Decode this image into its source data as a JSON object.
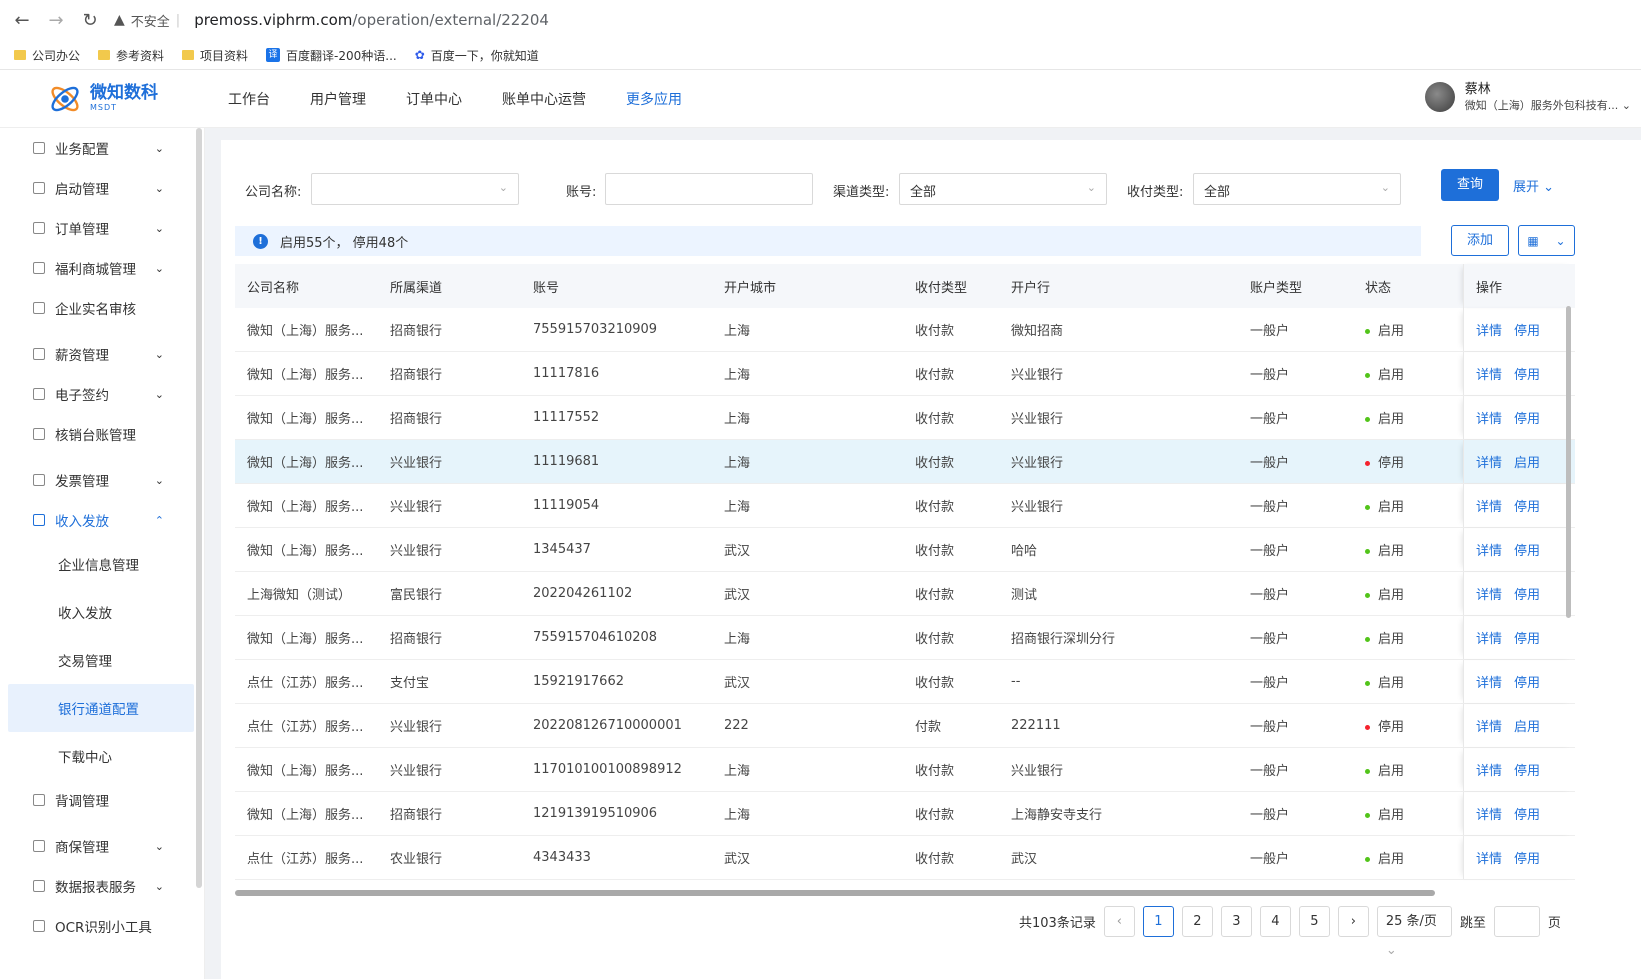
{
  "browser": {
    "security": "不安全",
    "url_host": "premoss.viphrm.com",
    "url_path": "/operation/external/22204",
    "bookmarks": [
      "公司办公",
      "参考资料",
      "项目资料",
      "百度翻译-200种语...",
      "百度一下，你就知道"
    ]
  },
  "header": {
    "logo_cn": "微知数科",
    "logo_en": "MSDT",
    "menu": [
      "工作台",
      "用户管理",
      "订单中心",
      "账单中心运营",
      "更多应用"
    ],
    "user_name": "蔡林",
    "user_org": "微知（上海）服务外包科技有...",
    "accent": "#1e6fd9"
  },
  "sidebar": {
    "items": [
      "业务配置",
      "启动管理",
      "订单管理",
      "福利商城管理",
      "企业实名审核",
      "薪资管理",
      "电子签约",
      "核销台账管理",
      "发票管理",
      "收入发放"
    ],
    "sub_items": [
      "企业信息管理",
      "收入发放",
      "交易管理",
      "银行通道配置",
      "下载中心"
    ],
    "bottom_items": [
      "背调管理",
      "商保管理",
      "数据报表服务",
      "OCR识别小工具"
    ]
  },
  "filters": {
    "company_label": "公司名称:",
    "account_label": "账号:",
    "channel_label": "渠道类型:",
    "channel_value": "全部",
    "pay_label": "收付类型:",
    "pay_value": "全部",
    "query": "查询",
    "expand": "展开"
  },
  "info": {
    "text": "启用55个， 停用48个",
    "add": "添加"
  },
  "table": {
    "columns": [
      "公司名称",
      "所属渠道",
      "账号",
      "开户城市",
      "收付类型",
      "开户行",
      "账户类型",
      "状态",
      "操作"
    ],
    "rows": [
      [
        "微知（上海）服务...",
        "招商银行",
        "755915703210909",
        "上海",
        "收付款",
        "微知招商",
        "一般户",
        "启用",
        "详情",
        "停用"
      ],
      [
        "微知（上海）服务...",
        "招商银行",
        "11117816",
        "上海",
        "收付款",
        "兴业银行",
        "一般户",
        "启用",
        "详情",
        "停用"
      ],
      [
        "微知（上海）服务...",
        "招商银行",
        "11117552",
        "上海",
        "收付款",
        "兴业银行",
        "一般户",
        "启用",
        "详情",
        "停用"
      ],
      [
        "微知（上海）服务...",
        "兴业银行",
        "11119681",
        "上海",
        "收付款",
        "兴业银行",
        "一般户",
        "停用",
        "详情",
        "启用"
      ],
      [
        "微知（上海）服务...",
        "兴业银行",
        "11119054",
        "上海",
        "收付款",
        "兴业银行",
        "一般户",
        "启用",
        "详情",
        "停用"
      ],
      [
        "微知（上海）服务...",
        "兴业银行",
        "1345437",
        "武汉",
        "收付款",
        "哈哈",
        "一般户",
        "启用",
        "详情",
        "停用"
      ],
      [
        "上海微知（测试）",
        "富民银行",
        "202204261102",
        "武汉",
        "收付款",
        "测试",
        "一般户",
        "启用",
        "详情",
        "停用"
      ],
      [
        "微知（上海）服务...",
        "招商银行",
        "755915704610208",
        "上海",
        "收付款",
        "招商银行深圳分行",
        "一般户",
        "启用",
        "详情",
        "停用"
      ],
      [
        "点仕（江苏）服务...",
        "支付宝",
        "15921917662",
        "武汉",
        "收付款",
        "--",
        "一般户",
        "启用",
        "详情",
        "停用"
      ],
      [
        "点仕（江苏）服务...",
        "兴业银行",
        "202208126710000001",
        "222",
        "付款",
        "222111",
        "一般户",
        "停用",
        "详情",
        "启用"
      ],
      [
        "微知（上海）服务...",
        "兴业银行",
        "117010100100898912",
        "上海",
        "收付款",
        "兴业银行",
        "一般户",
        "启用",
        "详情",
        "停用"
      ],
      [
        "微知（上海）服务...",
        "招商银行",
        "121913919510906",
        "上海",
        "收付款",
        "上海静安寺支行",
        "一般户",
        "启用",
        "详情",
        "停用"
      ],
      [
        "点仕（江苏）服务...",
        "农业银行",
        "4343433",
        "武汉",
        "收付款",
        "武汉",
        "一般户",
        "启用",
        "详情",
        "停用"
      ]
    ],
    "status_colors": {
      "启用": "#52c41a",
      "停用": "#f5222d"
    }
  },
  "pagination": {
    "total": "共103条记录",
    "pages": [
      "1",
      "2",
      "3",
      "4",
      "5"
    ],
    "current": "1",
    "page_size": "25 条/页",
    "jump_label": "跳至",
    "page_unit": "页"
  }
}
